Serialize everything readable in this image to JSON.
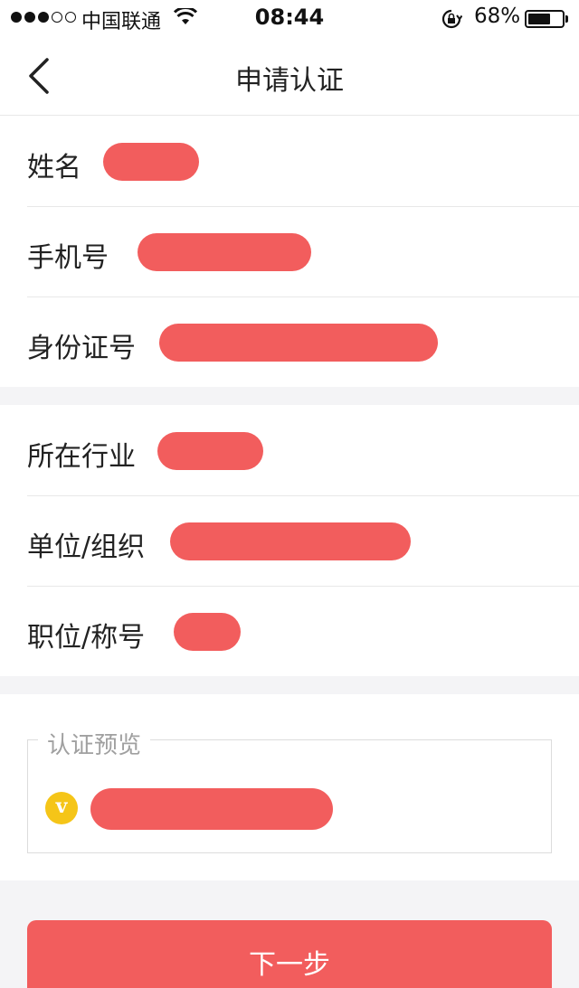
{
  "status_bar": {
    "carrier": "中国联通",
    "time": "08:44",
    "battery_percent": "68%",
    "battery_level": 0.68,
    "signal_bars_filled": 3,
    "signal_bars_total": 5
  },
  "nav": {
    "title": "申请认证",
    "back_icon": "chevron-left-icon"
  },
  "form": {
    "group1": [
      {
        "label": "姓名",
        "value": ""
      },
      {
        "label": "手机号",
        "value": ""
      },
      {
        "label": "身份证号",
        "value": ""
      }
    ],
    "group2": [
      {
        "label": "所在行业",
        "value": ""
      },
      {
        "label": "单位/组织",
        "value": ""
      },
      {
        "label": "职位/称号",
        "value": ""
      }
    ]
  },
  "preview": {
    "legend": "认证预览",
    "badge_letter": "v",
    "value": ""
  },
  "next_button": {
    "label": "下一步"
  },
  "colors": {
    "accent": "#f25d5d",
    "badge": "#f5c518",
    "background": "#f4f4f6"
  }
}
